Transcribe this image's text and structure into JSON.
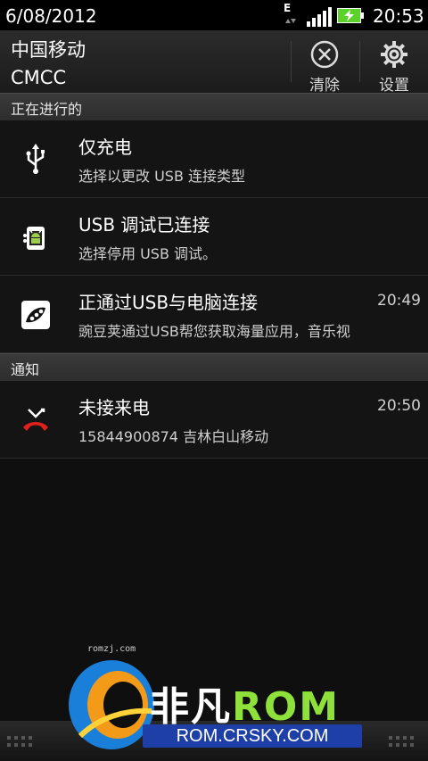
{
  "status_bar": {
    "date": "6/08/2012",
    "time": "20:53",
    "network_type": "E",
    "icons": [
      "network-activity-icon",
      "signal-icon",
      "battery-charging-icon"
    ]
  },
  "header": {
    "carrier_line1": "中国移动",
    "carrier_line2": "CMCC",
    "clear_label": "清除",
    "settings_label": "设置"
  },
  "sections": {
    "ongoing": "正在进行的",
    "notifications": "通知"
  },
  "ongoing_items": [
    {
      "icon": "usb-icon",
      "title": "仅充电",
      "subtitle": "选择以更改 USB 连接类型",
      "time": ""
    },
    {
      "icon": "android-debug-icon",
      "title": "USB 调试已连接",
      "subtitle": "选择停用 USB 调试。",
      "time": ""
    },
    {
      "icon": "wandoujia-icon",
      "title": "正通过USB与电脑连接",
      "subtitle": "豌豆荚通过USB帮您获取海量应用，音乐视",
      "time": "20:49"
    }
  ],
  "notification_items": [
    {
      "icon": "missed-call-icon",
      "title": "未接来电",
      "subtitle": "15844900874 吉林白山移动",
      "time": "20:50"
    }
  ],
  "watermark": {
    "small_text": "romzj.com",
    "brand_prefix": "非凡",
    "brand_suffix": "ROM",
    "url": "ROM.CRSKY.COM"
  },
  "colors": {
    "background": "#0f0f0f",
    "battery": "#5bd22a",
    "missed_call": "#e0201b",
    "brand_green": "#8ee13a",
    "brand_blue": "#1e3fa8"
  }
}
